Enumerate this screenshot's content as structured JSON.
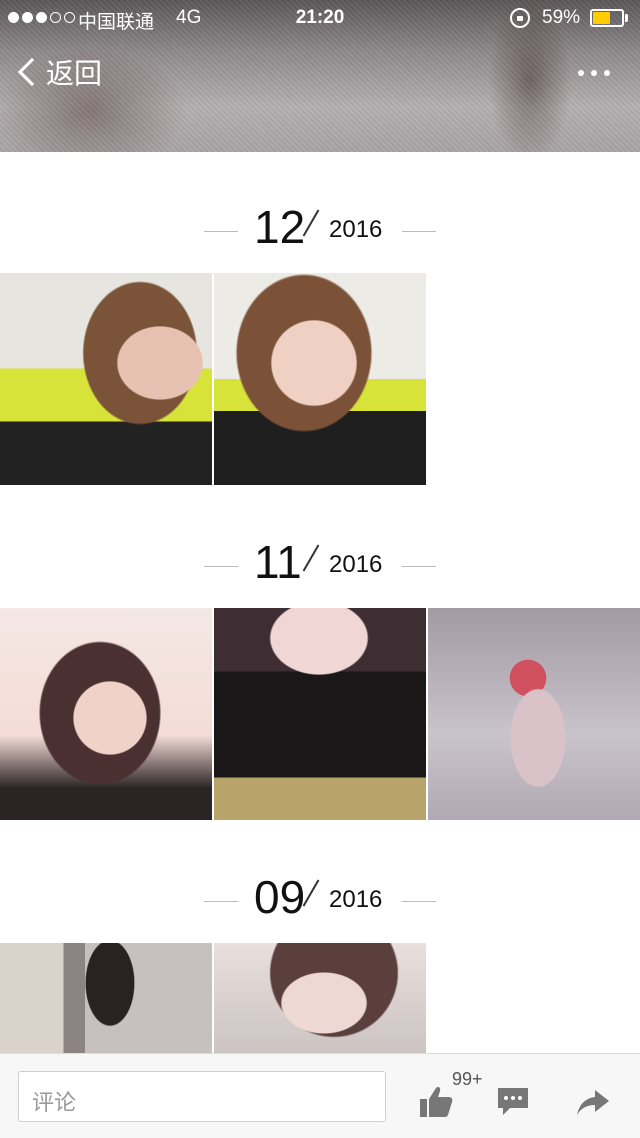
{
  "status_bar": {
    "carrier": "中国联通",
    "network": "4G",
    "time": "21:20",
    "battery_percent": "59%",
    "battery_level": 0.59,
    "signal_bars_filled": 3,
    "signal_bars_total": 5
  },
  "nav": {
    "back_label": "返回",
    "back_icon": "chevron-left-icon",
    "more_icon": "more-dots-icon"
  },
  "albums": [
    {
      "month": "12",
      "year": "2016",
      "photo_count": 2
    },
    {
      "month": "11",
      "year": "2016",
      "photo_count": 3
    },
    {
      "month": "09",
      "year": "2016",
      "photo_count": 2
    }
  ],
  "bottom_bar": {
    "comment_placeholder": "评论",
    "like_count": "99+",
    "like_icon": "thumbs-up-icon",
    "comment_icon": "chat-bubble-icon",
    "share_icon": "share-arrow-icon"
  },
  "colors": {
    "battery_fill": "#ffcc00",
    "icon_gray": "#777777"
  }
}
